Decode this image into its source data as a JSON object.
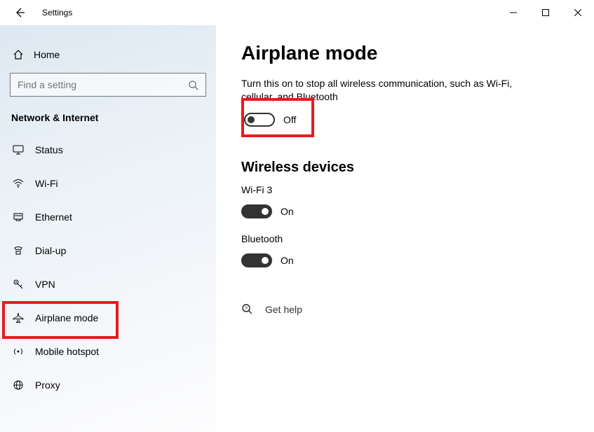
{
  "window": {
    "title": "Settings"
  },
  "sidebar": {
    "home": "Home",
    "search_placeholder": "Find a setting",
    "category": "Network & Internet",
    "items": [
      {
        "icon": "monitor-icon",
        "label": "Status"
      },
      {
        "icon": "wifi-icon",
        "label": "Wi-Fi"
      },
      {
        "icon": "ethernet-icon",
        "label": "Ethernet"
      },
      {
        "icon": "dialup-icon",
        "label": "Dial-up"
      },
      {
        "icon": "key-icon",
        "label": "VPN"
      },
      {
        "icon": "airplane-icon",
        "label": "Airplane mode"
      },
      {
        "icon": "hotspot-icon",
        "label": "Mobile hotspot"
      },
      {
        "icon": "globe-icon",
        "label": "Proxy"
      }
    ]
  },
  "main": {
    "heading": "Airplane mode",
    "description": "Turn this on to stop all wireless communication, such as Wi-Fi, cellular, and Bluetooth",
    "airplane_toggle": {
      "state": "off",
      "label": "Off"
    },
    "wireless_heading": "Wireless devices",
    "devices": [
      {
        "name": "Wi-Fi 3",
        "state": "on",
        "label": "On"
      },
      {
        "name": "Bluetooth",
        "state": "on",
        "label": "On"
      }
    ],
    "help": "Get help"
  }
}
